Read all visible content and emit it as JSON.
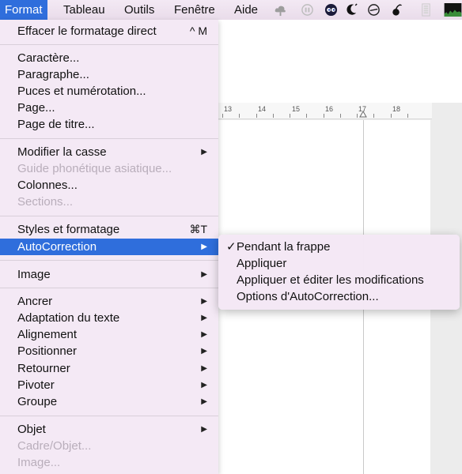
{
  "menubar": {
    "items": [
      "Format",
      "Tableau",
      "Outils",
      "Fenêtre",
      "Aide"
    ],
    "status_icons": [
      "cloud-icon",
      "sync-icon",
      "eye-icon",
      "moon-icon",
      "timer-icon",
      "cherry-icon",
      "battery-icon",
      "cpu-graph-icon"
    ]
  },
  "ruler": {
    "numbers": [
      "13",
      "14",
      "15",
      "16",
      "17",
      "18"
    ]
  },
  "menu": {
    "clear_formatting": {
      "label": "Effacer le formatage direct",
      "shortcut": "^ M"
    },
    "caractere": "Caractère...",
    "paragraphe": "Paragraphe...",
    "puces": "Puces et numérotation...",
    "page": "Page...",
    "page_titre": "Page de titre...",
    "modifier_casse": "Modifier la casse",
    "guide_phonetique": "Guide phonétique asiatique...",
    "colonnes": "Colonnes...",
    "sections": "Sections...",
    "styles": {
      "label": "Styles et formatage",
      "shortcut": "⌘T"
    },
    "autocorrection": "AutoCorrection",
    "image": "Image",
    "ancrer": "Ancrer",
    "adaptation": "Adaptation du texte",
    "alignement": "Alignement",
    "positionner": "Positionner",
    "retourner": "Retourner",
    "pivoter": "Pivoter",
    "groupe": "Groupe",
    "objet": "Objet",
    "cadre_objet": "Cadre/Objet...",
    "image_disabled": "Image..."
  },
  "submenu": {
    "pendant_frappe": "Pendant la frappe",
    "check": "✓",
    "appliquer": "Appliquer",
    "appliquer_editer": "Appliquer et éditer les modifications",
    "options": "Options d'AutoCorrection..."
  },
  "colors": {
    "highlight": "#2f6edc",
    "menu_bg": "#f4e8f5",
    "disabled_text": "#b9aebb"
  }
}
